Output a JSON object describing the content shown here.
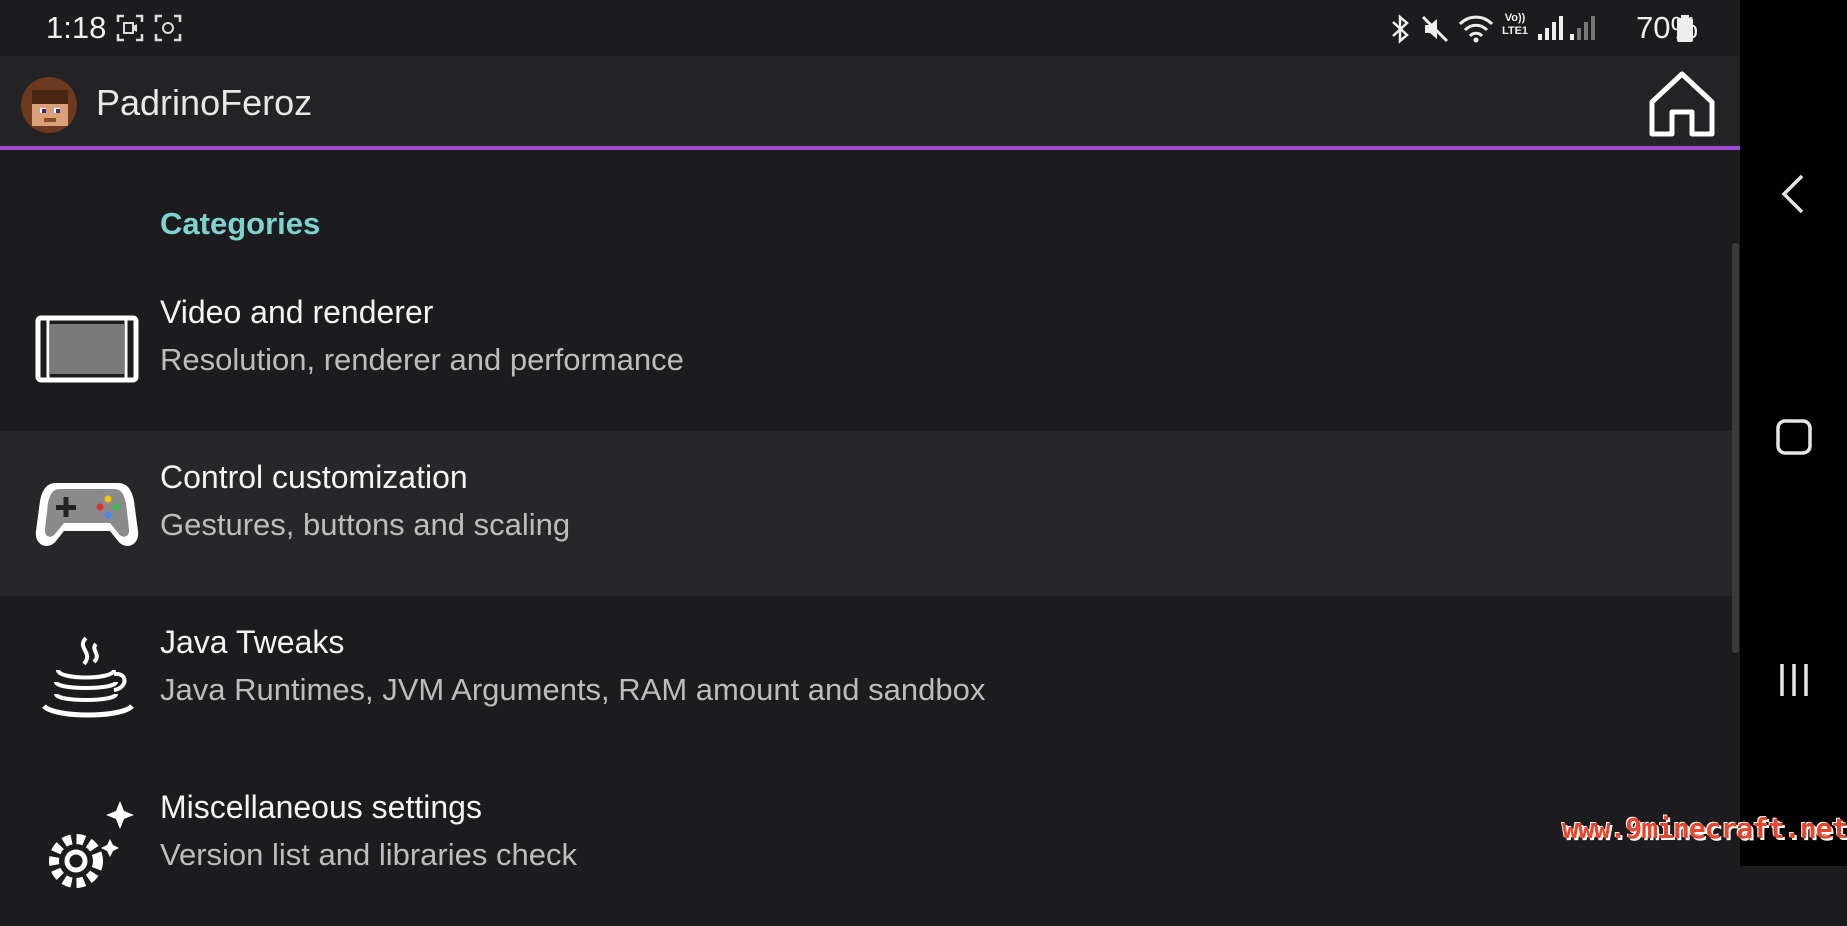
{
  "status_bar": {
    "time": "1:18",
    "battery": "70%",
    "icons": [
      "screen-record-icon",
      "screenshot-icon",
      "bluetooth-icon",
      "mute-icon",
      "wifi-icon",
      "volte-icon",
      "signal-icon",
      "signal-icon",
      "battery-icon"
    ],
    "volte_label_top": "Vo))",
    "volte_label_bottom": "LTE1"
  },
  "app_bar": {
    "username": "PadrinoFeroz",
    "accent_color": "#9c4bd1"
  },
  "settings": {
    "section_title": "Categories",
    "items": [
      {
        "title": "Video and renderer",
        "subtitle": "Resolution, renderer and performance",
        "icon": "display-icon"
      },
      {
        "title": "Control customization",
        "subtitle": "Gestures, buttons and scaling",
        "icon": "gamepad-icon"
      },
      {
        "title": "Java Tweaks",
        "subtitle": "Java Runtimes, JVM Arguments, RAM amount and sandbox",
        "icon": "java-icon"
      },
      {
        "title": "Miscellaneous settings",
        "subtitle": "Version list and libraries check",
        "icon": "settings-sparkle-icon"
      }
    ]
  },
  "navigation": {
    "back": "back-icon",
    "home": "home-circle-icon",
    "recents": "recents-icon"
  },
  "watermark": "www.9minecraft.net"
}
